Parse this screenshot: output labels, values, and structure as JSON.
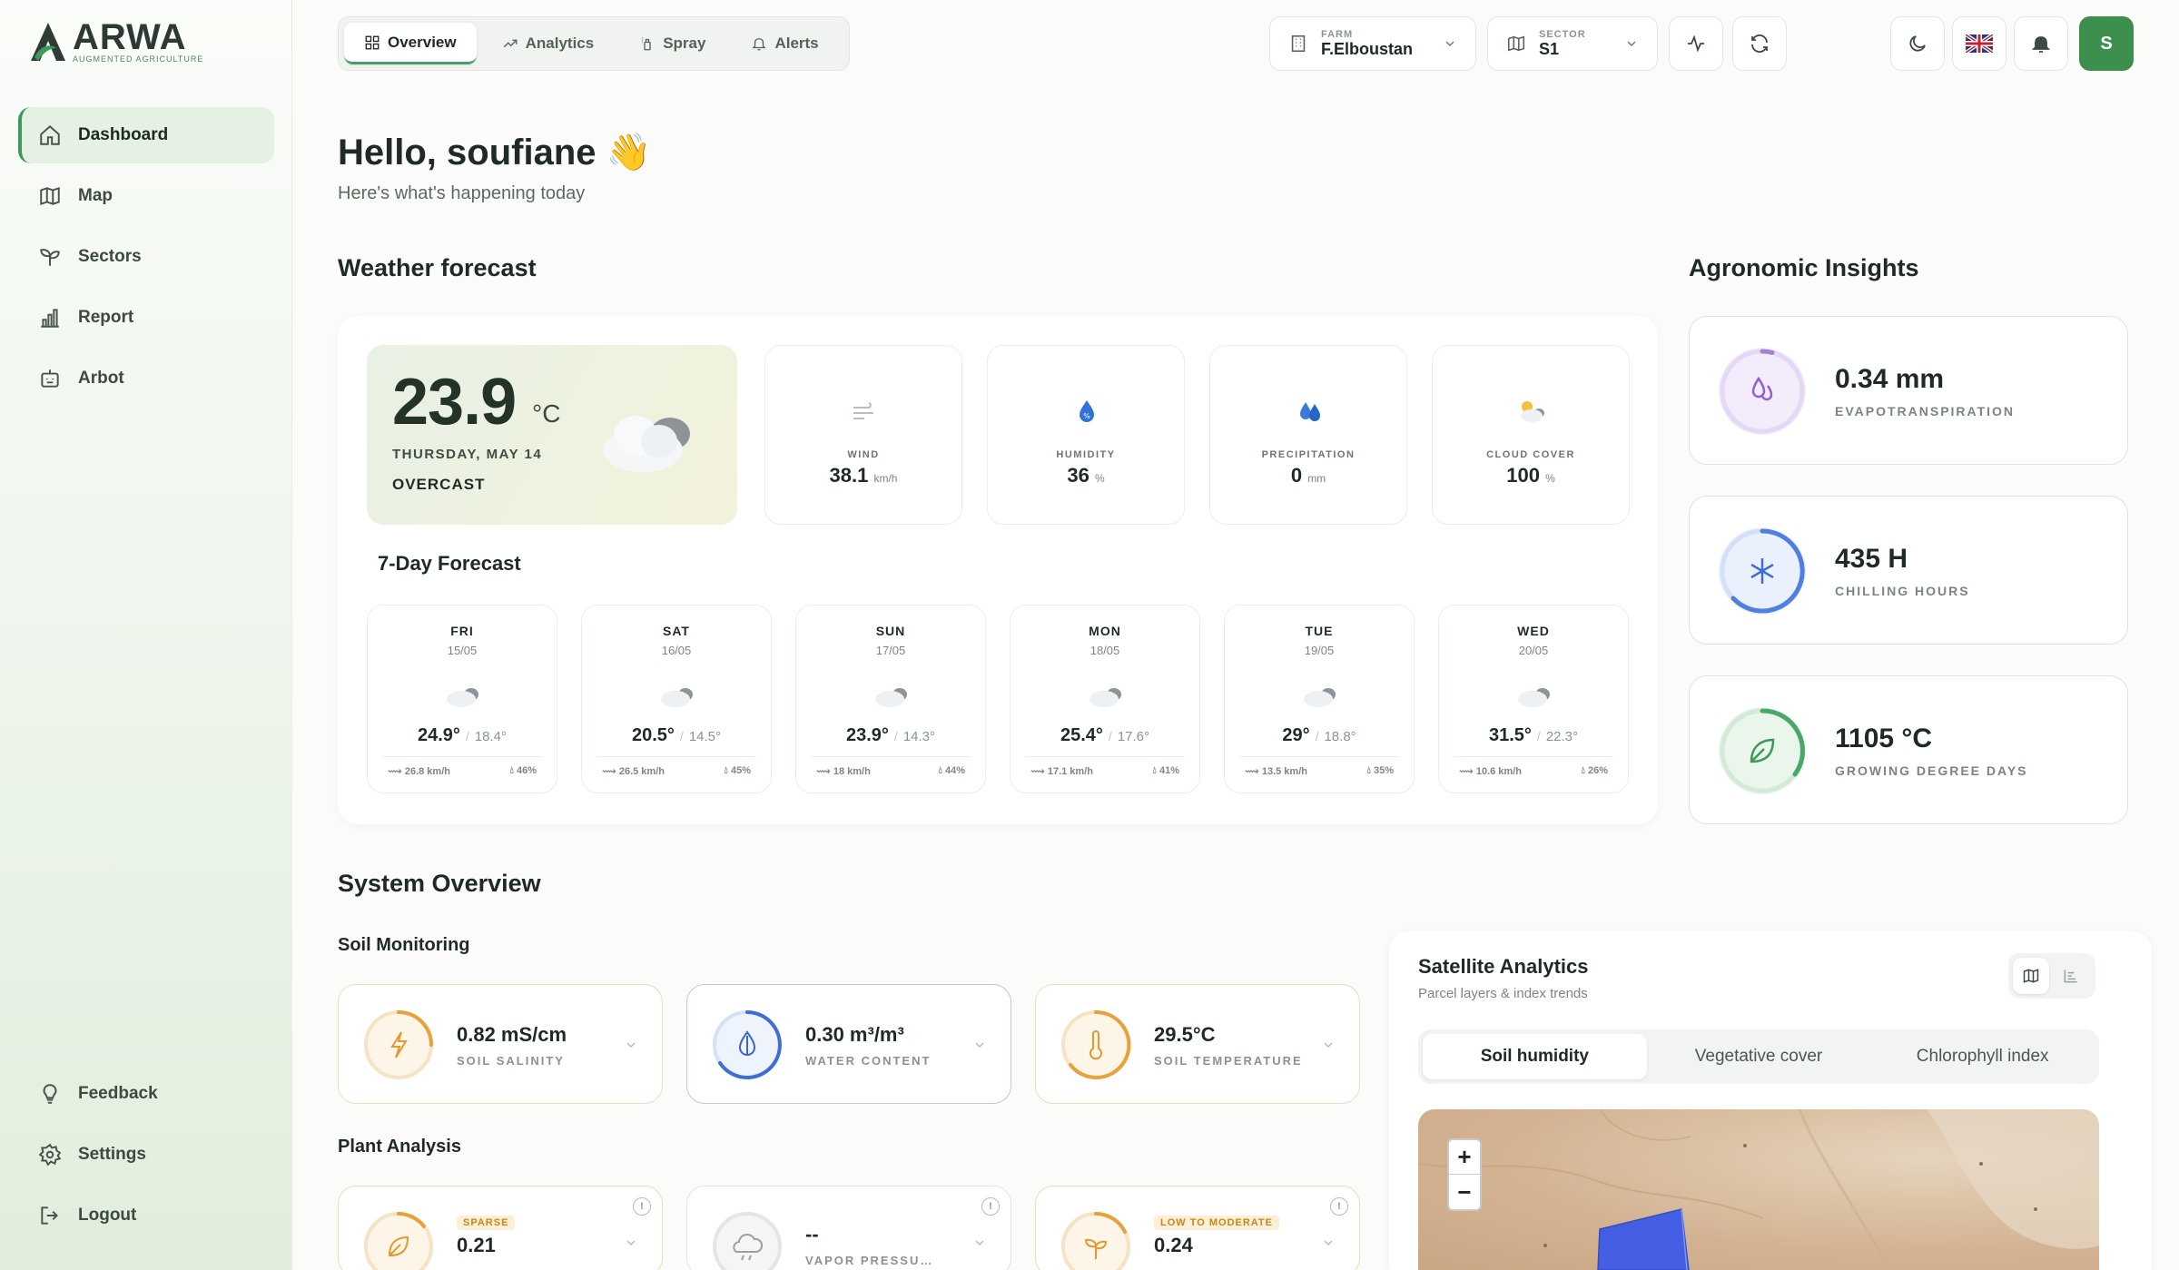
{
  "app": {
    "name": "ARWA",
    "tagline": "AUGMENTED AGRICULTURE"
  },
  "sidebar": {
    "items": [
      {
        "label": "Dashboard",
        "icon": "home-icon",
        "active": true
      },
      {
        "label": "Map",
        "icon": "map-icon"
      },
      {
        "label": "Sectors",
        "icon": "sprout-icon"
      },
      {
        "label": "Report",
        "icon": "bar-chart-icon"
      },
      {
        "label": "Arbot",
        "icon": "robot-icon"
      }
    ],
    "bottom": [
      {
        "label": "Feedback",
        "icon": "lightbulb-icon"
      },
      {
        "label": "Settings",
        "icon": "gear-icon"
      },
      {
        "label": "Logout",
        "icon": "logout-icon"
      }
    ]
  },
  "tabs": [
    "Overview",
    "Analytics",
    "Spray",
    "Alerts"
  ],
  "farm": {
    "label": "FARM",
    "value": "F.Elboustan"
  },
  "sector": {
    "label": "SECTOR",
    "value": "S1"
  },
  "user": {
    "initial": "S"
  },
  "greeting": {
    "title": "Hello, soufiane 👋",
    "subtitle": "Here's what's happening today"
  },
  "weather": {
    "section_title": "Weather forecast",
    "temp": "23.9",
    "unit": "°C",
    "date": "THURSDAY, MAY 14",
    "condition": "OVERCAST",
    "metrics": [
      {
        "label": "WIND",
        "value": "38.1",
        "unit": "km/h",
        "icon": "wind-icon"
      },
      {
        "label": "HUMIDITY",
        "value": "36",
        "unit": "%",
        "icon": "humidity-drop-icon"
      },
      {
        "label": "PRECIPITATION",
        "value": "0",
        "unit": "mm",
        "icon": "rain-drop-icon"
      },
      {
        "label": "CLOUD COVER",
        "value": "100",
        "unit": "%",
        "icon": "partly-cloudy-icon"
      }
    ],
    "forecast_title": "7-Day Forecast",
    "forecast": [
      {
        "day": "FRI",
        "date": "15/05",
        "high": "24.9°",
        "low": "18.4°",
        "wind": "26.8 km/h",
        "hum": "46%"
      },
      {
        "day": "SAT",
        "date": "16/05",
        "high": "20.5°",
        "low": "14.5°",
        "wind": "26.5 km/h",
        "hum": "45%"
      },
      {
        "day": "SUN",
        "date": "17/05",
        "high": "23.9°",
        "low": "14.3°",
        "wind": "18 km/h",
        "hum": "44%"
      },
      {
        "day": "MON",
        "date": "18/05",
        "high": "25.4°",
        "low": "17.6°",
        "wind": "17.1 km/h",
        "hum": "41%"
      },
      {
        "day": "TUE",
        "date": "19/05",
        "high": "29°",
        "low": "18.8°",
        "wind": "13.5 km/h",
        "hum": "35%"
      },
      {
        "day": "WED",
        "date": "20/05",
        "high": "31.5°",
        "low": "22.3°",
        "wind": "10.6 km/h",
        "hum": "26%"
      }
    ]
  },
  "insights": {
    "title": "Agronomic Insights",
    "items": [
      {
        "value": "0.34 mm",
        "label": "EVAPOTRANSPIRATION",
        "color": "#a77fd8",
        "icon": "droplets-icon"
      },
      {
        "value": "435 H",
        "label": "CHILLING HOURS",
        "color": "#4f7fe0",
        "icon": "snowflake-icon"
      },
      {
        "value": "1105 °C",
        "label": "GROWING DEGREE DAYS",
        "color": "#49a868",
        "icon": "leaf-icon"
      }
    ]
  },
  "system": {
    "title": "System Overview",
    "soil_title": "Soil Monitoring",
    "soil": [
      {
        "value": "0.82 mS/cm",
        "label": "SOIL SALINITY",
        "icon": "bolt-icon",
        "color": "#e9a13b"
      },
      {
        "value": "0.30 m³/m³",
        "label": "WATER CONTENT",
        "icon": "water-drop-icon",
        "color": "#3f6fd6"
      },
      {
        "value": "29.5°C",
        "label": "SOIL TEMPERATURE",
        "icon": "thermometer-icon",
        "color": "#e9a13b"
      }
    ],
    "plant_title": "Plant Analysis",
    "plant": [
      {
        "badge": "SPARSE",
        "value": "0.21",
        "label": "",
        "icon": "leaf-icon"
      },
      {
        "badge": "",
        "value": "--",
        "label": "VAPOR PRESSURE DEFICIT",
        "icon": "cloud-icon"
      },
      {
        "badge": "LOW TO MODERATE",
        "value": "0.24",
        "label": "",
        "icon": "sprout-icon"
      }
    ]
  },
  "satellite": {
    "title": "Satellite Analytics",
    "subtitle": "Parcel layers & index trends",
    "tabs": [
      "Soil humidity",
      "Vegetative cover",
      "Chlorophyll index"
    ],
    "zoom_in": "+",
    "zoom_out": "−"
  },
  "colors": {
    "accent": "#3d8f4e",
    "parcel": "#3d5be8"
  }
}
